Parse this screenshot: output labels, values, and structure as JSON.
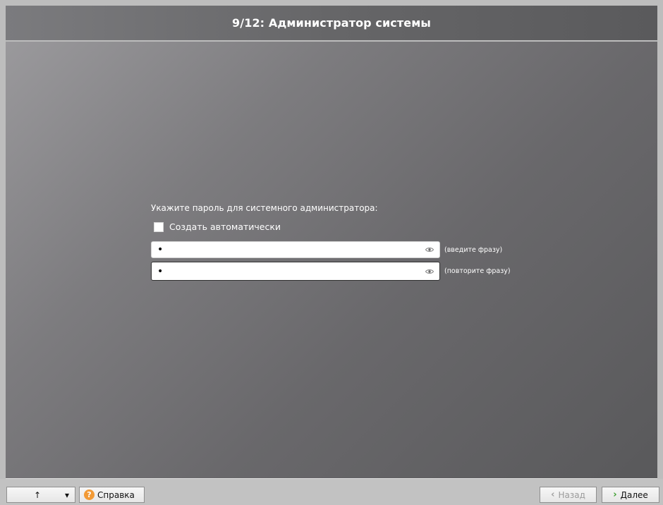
{
  "header": {
    "title": "9/12: Администратор системы"
  },
  "form": {
    "prompt": "Укажите пароль для системного администратора:",
    "auto_label": "Создать автоматически",
    "password1_value": "•",
    "password1_hint": "(введите фразу)",
    "password2_value": "•",
    "password2_hint": "(повторите фразу)",
    "eye_icon": "eye-icon"
  },
  "footer": {
    "up_arrow": "↑",
    "dropdown_arrow": "▾",
    "help_glyph": "?",
    "help_label": "Справка",
    "back_chevron": "‹",
    "back_label": "Назад",
    "next_chevron": "›",
    "next_label": "Далее"
  },
  "colors": {
    "help_orange": "#f29a36",
    "next_green": "#3b9d2e"
  }
}
